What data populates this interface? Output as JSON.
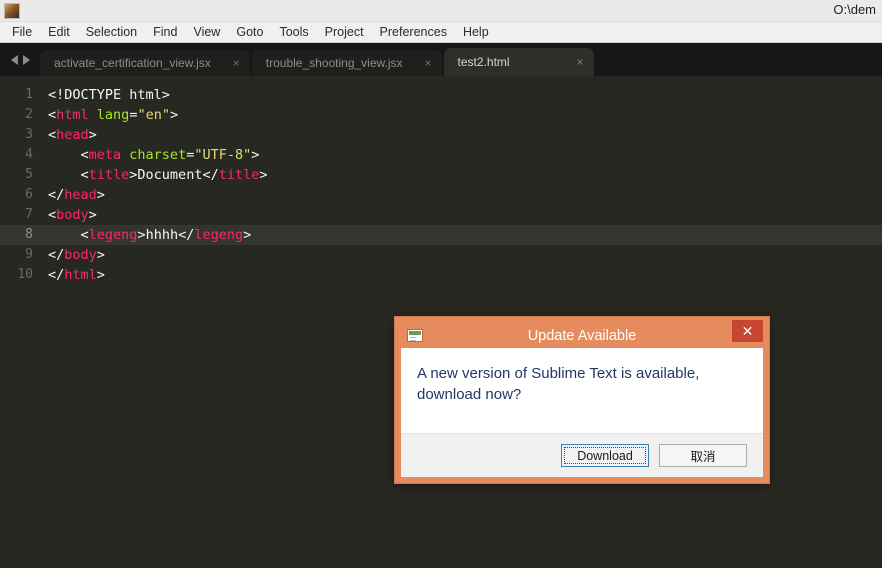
{
  "window": {
    "title": "O:\\dem",
    "app_icon": "sublime-text-icon"
  },
  "menubar": {
    "items": [
      {
        "label": "File"
      },
      {
        "label": "Edit"
      },
      {
        "label": "Selection"
      },
      {
        "label": "Find"
      },
      {
        "label": "View"
      },
      {
        "label": "Goto"
      },
      {
        "label": "Tools"
      },
      {
        "label": "Project"
      },
      {
        "label": "Preferences"
      },
      {
        "label": "Help"
      }
    ]
  },
  "tabbar": {
    "nav_back": "◀",
    "nav_forward": "▶",
    "close_glyph": "×",
    "tabs": [
      {
        "label": "activate_certification_view.jsx",
        "active": false
      },
      {
        "label": "trouble_shooting_view.jsx",
        "active": false
      },
      {
        "label": "test2.html",
        "active": true
      }
    ]
  },
  "editor": {
    "current_line": 8,
    "line_numbers": [
      "1",
      "2",
      "3",
      "4",
      "5",
      "6",
      "7",
      "8",
      "9",
      "10"
    ],
    "lines": [
      {
        "n": 1,
        "raw": "<!DOCTYPE html>"
      },
      {
        "n": 2,
        "raw": "<html lang=\"en\">"
      },
      {
        "n": 3,
        "raw": "<head>"
      },
      {
        "n": 4,
        "raw": "    <meta charset=\"UTF-8\">"
      },
      {
        "n": 5,
        "raw": "    <title>Document</title>"
      },
      {
        "n": 6,
        "raw": "</head>"
      },
      {
        "n": 7,
        "raw": "<body>"
      },
      {
        "n": 8,
        "raw": "    <legeng>hhhh</legeng>"
      },
      {
        "n": 9,
        "raw": "</body>"
      },
      {
        "n": 10,
        "raw": "</html>"
      }
    ],
    "tokens": [
      [
        {
          "t": "<!DOCTYPE html>",
          "c": "tk-doctype"
        }
      ],
      [
        {
          "t": "<",
          "c": "tk-punct"
        },
        {
          "t": "html",
          "c": "tk-tag"
        },
        {
          "t": " ",
          "c": "tk-punct"
        },
        {
          "t": "lang",
          "c": "tk-attr"
        },
        {
          "t": "=",
          "c": "tk-punct"
        },
        {
          "t": "\"en\"",
          "c": "tk-string"
        },
        {
          "t": ">",
          "c": "tk-punct"
        }
      ],
      [
        {
          "t": "<",
          "c": "tk-punct"
        },
        {
          "t": "head",
          "c": "tk-tag"
        },
        {
          "t": ">",
          "c": "tk-punct"
        }
      ],
      [
        {
          "t": "    <",
          "c": "tk-punct"
        },
        {
          "t": "meta",
          "c": "tk-tag"
        },
        {
          "t": " ",
          "c": "tk-punct"
        },
        {
          "t": "charset",
          "c": "tk-attr"
        },
        {
          "t": "=",
          "c": "tk-punct"
        },
        {
          "t": "\"UTF-8\"",
          "c": "tk-string"
        },
        {
          "t": ">",
          "c": "tk-punct"
        }
      ],
      [
        {
          "t": "    <",
          "c": "tk-punct"
        },
        {
          "t": "title",
          "c": "tk-tag"
        },
        {
          "t": ">",
          "c": "tk-punct"
        },
        {
          "t": "Document",
          "c": "tk-text"
        },
        {
          "t": "</",
          "c": "tk-punct"
        },
        {
          "t": "title",
          "c": "tk-tag"
        },
        {
          "t": ">",
          "c": "tk-punct"
        }
      ],
      [
        {
          "t": "</",
          "c": "tk-punct"
        },
        {
          "t": "head",
          "c": "tk-tag"
        },
        {
          "t": ">",
          "c": "tk-punct"
        }
      ],
      [
        {
          "t": "<",
          "c": "tk-punct"
        },
        {
          "t": "body",
          "c": "tk-tag"
        },
        {
          "t": ">",
          "c": "tk-punct"
        }
      ],
      [
        {
          "t": "    <",
          "c": "tk-punct"
        },
        {
          "t": "legeng",
          "c": "tk-bad"
        },
        {
          "t": ">",
          "c": "tk-punct"
        },
        {
          "t": "hhhh",
          "c": "tk-text"
        },
        {
          "t": "</",
          "c": "tk-punct"
        },
        {
          "t": "legeng",
          "c": "tk-bad"
        },
        {
          "t": ">",
          "c": "tk-punct"
        }
      ],
      [
        {
          "t": "</",
          "c": "tk-punct"
        },
        {
          "t": "body",
          "c": "tk-tag"
        },
        {
          "t": ">",
          "c": "tk-punct"
        }
      ],
      [
        {
          "t": "</",
          "c": "tk-punct"
        },
        {
          "t": "html",
          "c": "tk-tag"
        },
        {
          "t": ">",
          "c": "tk-punct"
        }
      ]
    ]
  },
  "dialog": {
    "title": "Update Available",
    "icon": "window-update-icon",
    "close_label": "✕",
    "message": "A new version of Sublime Text is available, download now?",
    "buttons": [
      {
        "label": "Download",
        "default": true
      },
      {
        "label": "取消",
        "default": false
      }
    ]
  },
  "colors": {
    "editor_bg": "#272822",
    "current_line": "#34352e",
    "tag": "#f92672",
    "attr": "#a6e22e",
    "string": "#e6db74",
    "dialog_accent": "#e58b5d",
    "dialog_close": "#c74632",
    "dialog_text": "#1f3864"
  }
}
